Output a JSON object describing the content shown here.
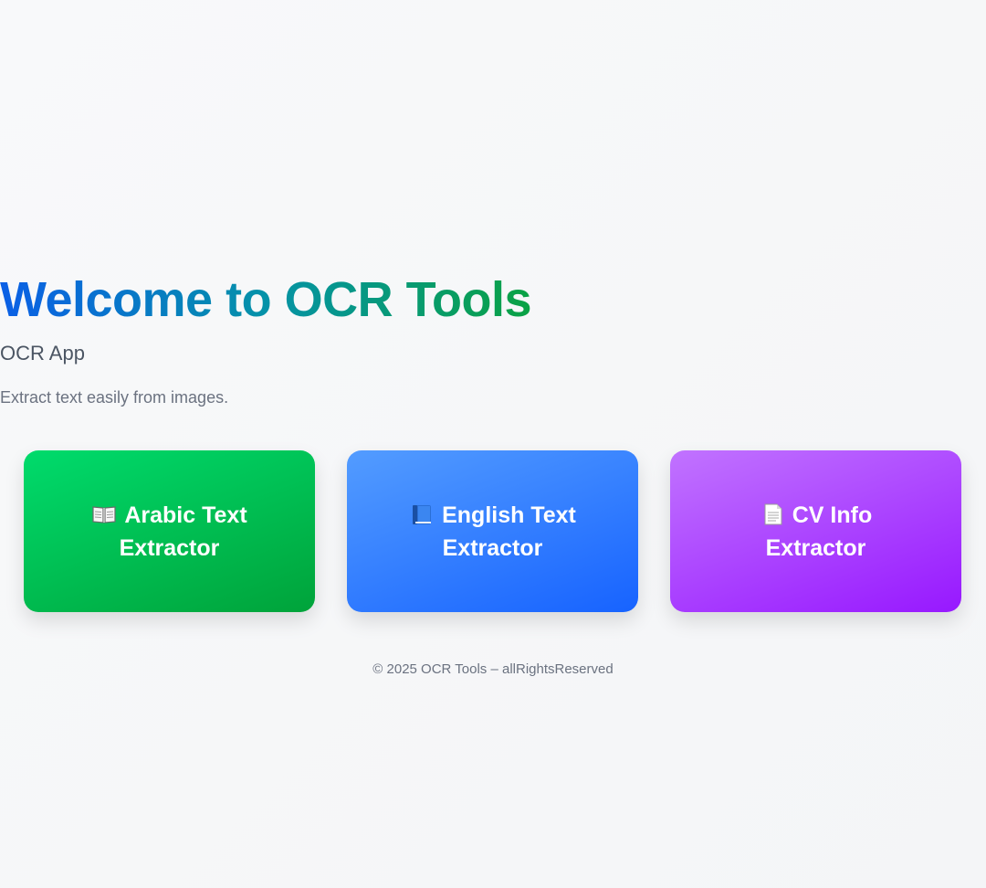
{
  "hero": {
    "title": "Welcome to OCR Tools",
    "subtitle": "OCR App",
    "tagline": "Extract text easily from images."
  },
  "cards": [
    {
      "icon": "open-book-icon",
      "label": "Arabic Text Extractor",
      "color_start": "#00db6c",
      "color_end": "#00a33a"
    },
    {
      "icon": "blue-book-icon",
      "label": "English Text Extractor",
      "color_start": "#539cff",
      "color_end": "#1763ff"
    },
    {
      "icon": "document-icon",
      "label": "CV Info Extractor",
      "color_start": "#c173ff",
      "color_end": "#9718ff"
    }
  ],
  "footer": {
    "text": "© 2025 OCR Tools – allRightsReserved"
  },
  "colors": {
    "title_gradient_start": "#0b5fe6",
    "title_gradient_end": "#0aa244",
    "background": "#f6f7f9"
  }
}
